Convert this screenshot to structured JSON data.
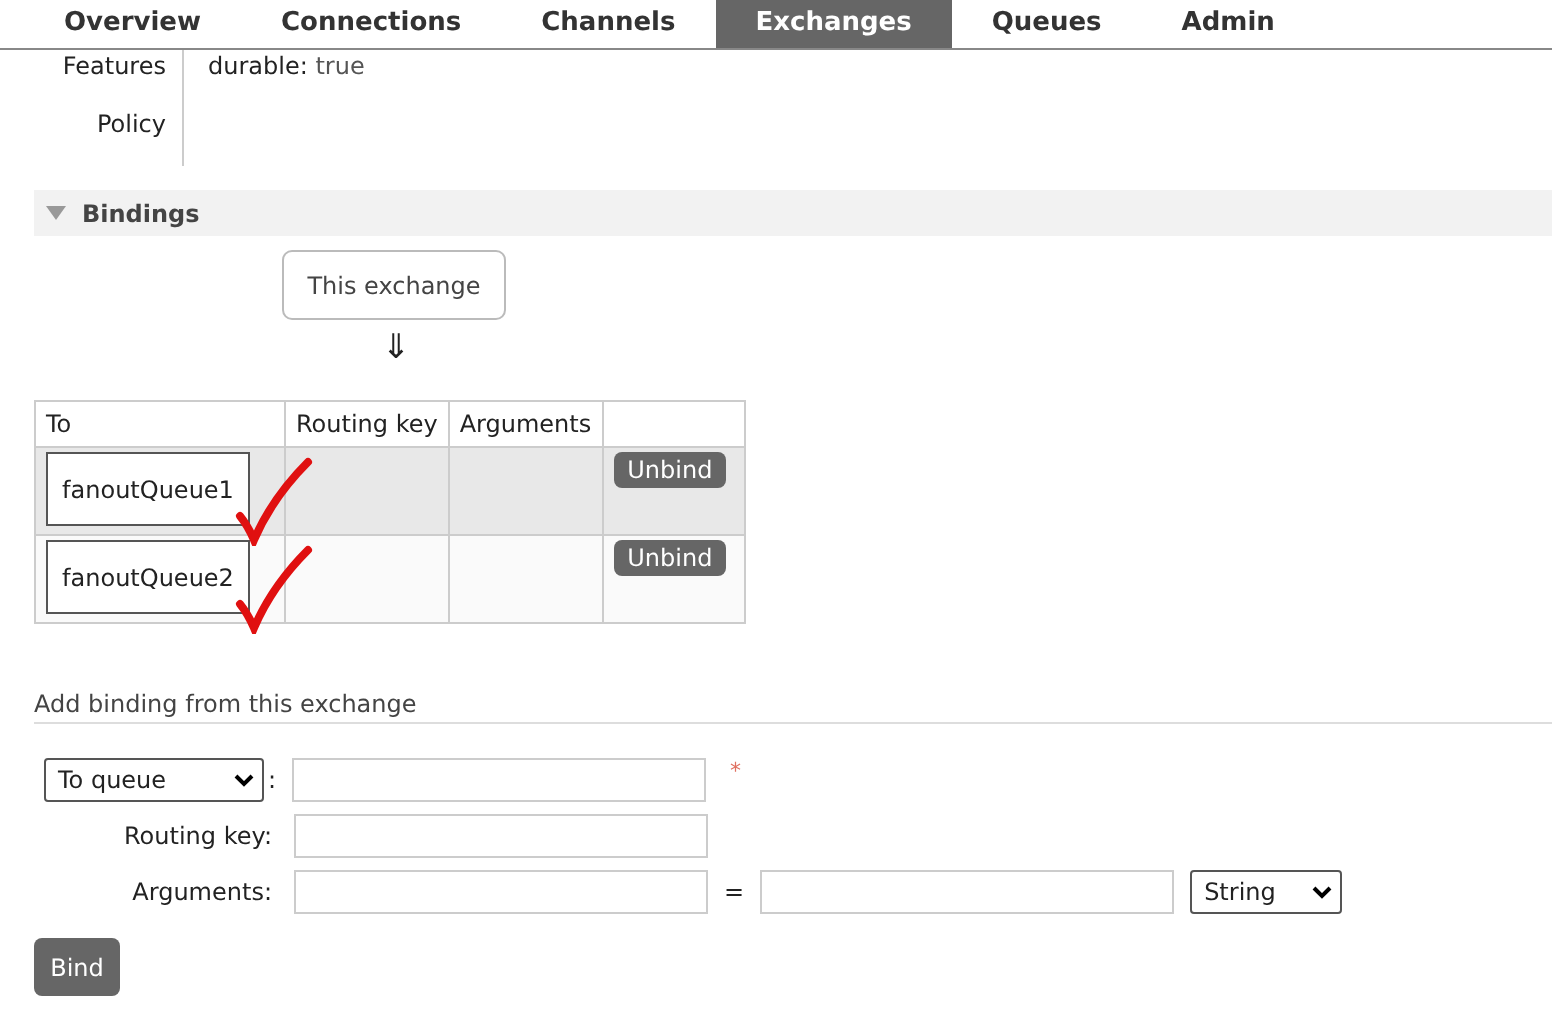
{
  "nav": {
    "tabs": [
      {
        "label": "Overview",
        "selected": false
      },
      {
        "label": "Connections",
        "selected": false
      },
      {
        "label": "Channels",
        "selected": false
      },
      {
        "label": "Exchanges",
        "selected": true
      },
      {
        "label": "Queues",
        "selected": false
      },
      {
        "label": "Admin",
        "selected": false
      }
    ]
  },
  "properties": [
    {
      "label": "Features",
      "key": "durable:",
      "value": "true"
    },
    {
      "label": "Policy"
    }
  ],
  "bindings": {
    "title": "Bindings",
    "expanded": true,
    "source": "This exchange",
    "arrow": "⇓",
    "columns": [
      "To",
      "Routing key",
      "Arguments"
    ],
    "rows": [
      {
        "to": "fanoutQueue1",
        "action": "Unbind",
        "checkmark": true
      },
      {
        "to": "fanoutQueue2",
        "action": "Unbind",
        "checkmark": true
      }
    ]
  },
  "add_binding": {
    "title": "Add binding from this exchange",
    "destination": "To queue",
    "colon": ":",
    "required_mark": "*",
    "routing_key_label": "Routing key:",
    "arguments_label": "Arguments:",
    "equals": "=",
    "type": "String",
    "button": "Bind"
  }
}
